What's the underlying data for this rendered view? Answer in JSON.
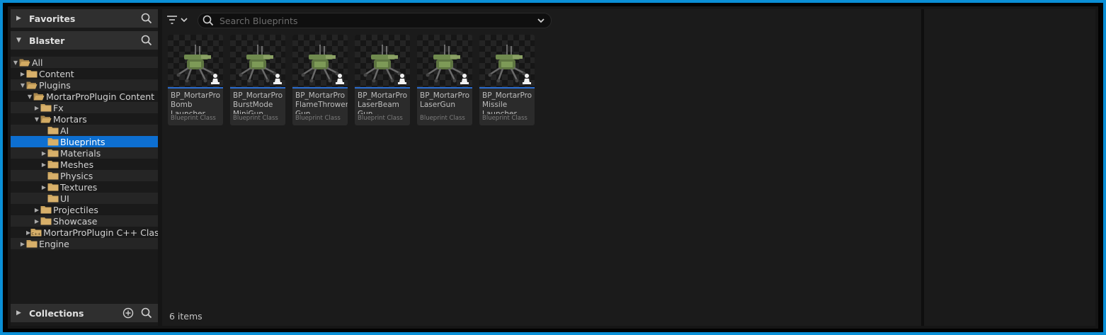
{
  "sidebar": {
    "favorites_label": "Favorites",
    "project_label": "Blaster",
    "collections_label": "Collections",
    "tree": [
      {
        "label": "All",
        "depth": 0,
        "open": true,
        "arrow": true
      },
      {
        "label": "Content",
        "depth": 1,
        "open": false,
        "arrow": true
      },
      {
        "label": "Plugins",
        "depth": 1,
        "open": true,
        "arrow": true
      },
      {
        "label": "MortarProPlugin Content",
        "depth": 2,
        "open": true,
        "arrow": true
      },
      {
        "label": "Fx",
        "depth": 3,
        "open": false,
        "arrow": true
      },
      {
        "label": "Mortars",
        "depth": 3,
        "open": true,
        "arrow": true
      },
      {
        "label": "AI",
        "depth": 4,
        "open": false,
        "arrow": false
      },
      {
        "label": "Blueprints",
        "depth": 4,
        "open": false,
        "arrow": false,
        "selected": true
      },
      {
        "label": "Materials",
        "depth": 4,
        "open": false,
        "arrow": true
      },
      {
        "label": "Meshes",
        "depth": 4,
        "open": false,
        "arrow": true
      },
      {
        "label": "Physics",
        "depth": 4,
        "open": false,
        "arrow": false
      },
      {
        "label": "Textures",
        "depth": 4,
        "open": false,
        "arrow": true
      },
      {
        "label": "UI",
        "depth": 4,
        "open": false,
        "arrow": false
      },
      {
        "label": "Projectiles",
        "depth": 3,
        "open": false,
        "arrow": true
      },
      {
        "label": "Showcase",
        "depth": 3,
        "open": false,
        "arrow": true
      },
      {
        "label": "MortarProPlugin C++ Classes",
        "depth": 2,
        "open": false,
        "arrow": true,
        "cpp": true
      },
      {
        "label": "Engine",
        "depth": 1,
        "open": false,
        "arrow": true
      }
    ]
  },
  "main": {
    "search_placeholder": "Search Blueprints",
    "assets": [
      {
        "name": "BP_MortarPro Bomb Launcher",
        "type": "Blueprint Class"
      },
      {
        "name": "BP_MortarPro BurstMode MiniGun",
        "type": "Blueprint Class"
      },
      {
        "name": "BP_MortarPro FlameThrower Gun",
        "type": "Blueprint Class"
      },
      {
        "name": "BP_MortarPro LaserBeam Gun",
        "type": "Blueprint Class"
      },
      {
        "name": "BP_MortarPro LaserGun",
        "type": "Blueprint Class"
      },
      {
        "name": "BP_MortarPro Missile Launcher",
        "type": "Blueprint Class"
      }
    ],
    "item_count": "6 items"
  },
  "colors": {
    "accent": "#0d6fd1",
    "border": "#0a8fd6",
    "folder": "#c9a25c"
  }
}
